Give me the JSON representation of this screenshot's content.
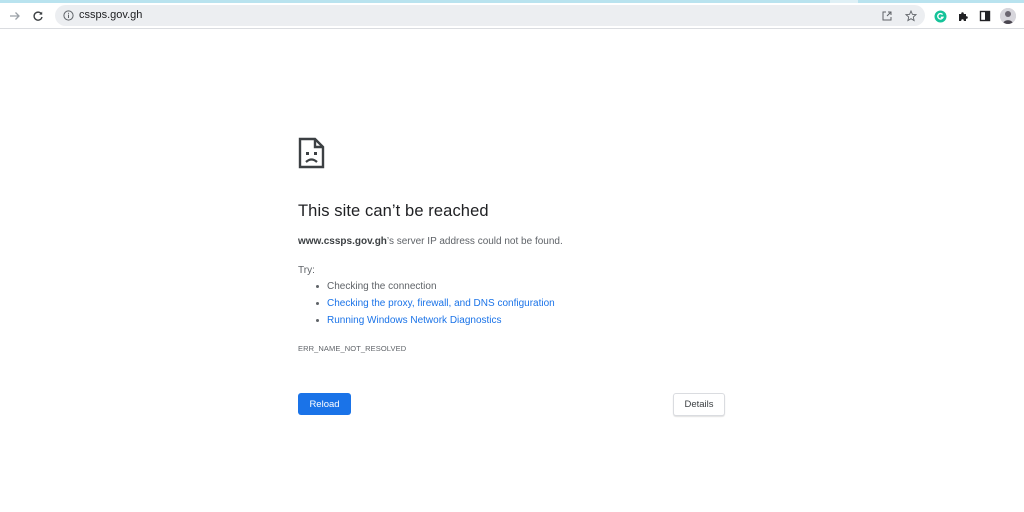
{
  "browser": {
    "url": "cssps.gov.gh",
    "icons": {
      "forward": "arrow-right-icon",
      "reload": "reload-icon",
      "site_info": "info-icon",
      "share": "share-icon",
      "bookmark": "star-icon",
      "grammarly": "grammarly-icon",
      "extensions": "puzzle-icon",
      "side_panel": "side-panel-icon",
      "profile": "avatar"
    }
  },
  "error_page": {
    "title": "This site can’t be reached",
    "host": "www.cssps.gov.gh",
    "detail_suffix": "’s server IP address could not be found.",
    "try_label": "Try:",
    "suggestions": [
      {
        "text": "Checking the connection",
        "link": false
      },
      {
        "text": "Checking the proxy, firewall, and DNS configuration",
        "link": true
      },
      {
        "text": "Running Windows Network Diagnostics",
        "link": true
      }
    ],
    "error_code": "ERR_NAME_NOT_RESOLVED",
    "reload_label": "Reload",
    "details_label": "Details"
  },
  "colors": {
    "accent": "#1a73e8",
    "grammarly": "#15c39a",
    "text_secondary": "#5f6368"
  }
}
